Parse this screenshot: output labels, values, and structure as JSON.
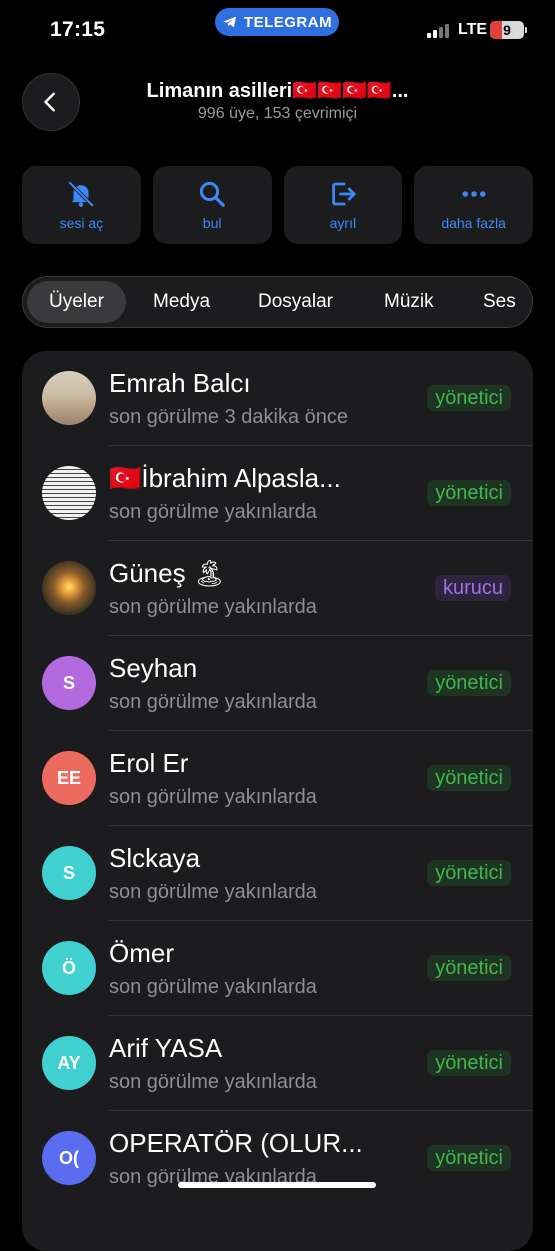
{
  "status_bar": {
    "time": "17:15",
    "app_pill": "TELEGRAM",
    "network": "LTE",
    "battery": "9"
  },
  "header": {
    "title": "Limanın asilleri🇹🇷🇹🇷🇹🇷🇹🇷...",
    "subtitle": "996 üye, 153 çevrimiçi"
  },
  "actions": [
    {
      "label": "sesi aç",
      "icon": "bell-slash-icon"
    },
    {
      "label": "bul",
      "icon": "search-icon"
    },
    {
      "label": "ayrıl",
      "icon": "leave-icon"
    },
    {
      "label": "daha fazla",
      "icon": "more-icon"
    }
  ],
  "tabs": [
    {
      "label": "Üyeler",
      "active": true
    },
    {
      "label": "Medya"
    },
    {
      "label": "Dosyalar"
    },
    {
      "label": "Müzik"
    },
    {
      "label": "Ses"
    }
  ],
  "members": [
    {
      "name": "Emrah Balcı",
      "status": "son görülme 3 dakika önce",
      "role": "yönetici",
      "avatar": "photo-beach",
      "initials": ""
    },
    {
      "name": "🇹🇷İbrahim Alpasla...",
      "status": "son görülme yakınlarda",
      "role": "yönetici",
      "avatar": "photo-text",
      "initials": ""
    },
    {
      "name": "Güneş 🏝",
      "status": "son görülme yakınlarda",
      "role": "kurucu",
      "avatar": "photo-sunset",
      "initials": ""
    },
    {
      "name": "Seyhan",
      "status": "son görülme yakınlarda",
      "role": "yönetici",
      "avatar": "initials",
      "initials": "S",
      "color": "#b36ae0"
    },
    {
      "name": "Erol Er",
      "status": "son görülme yakınlarda",
      "role": "yönetici",
      "avatar": "initials",
      "initials": "EE",
      "color": "#ec6a5e"
    },
    {
      "name": "Slckaya",
      "status": "son görülme yakınlarda",
      "role": "yönetici",
      "avatar": "initials",
      "initials": "S",
      "color": "#3fd0cf"
    },
    {
      "name": "Ömer",
      "status": "son görülme yakınlarda",
      "role": "yönetici",
      "avatar": "initials",
      "initials": "Ö",
      "color": "#3fd0cf"
    },
    {
      "name": "Arif YASA",
      "status": "son görülme yakınlarda",
      "role": "yönetici",
      "avatar": "initials",
      "initials": "AY",
      "color": "#3fd0cf"
    },
    {
      "name": "OPERATÖR (OLUR...",
      "status": "son görülme yakınlarda",
      "role": "yönetici",
      "avatar": "initials",
      "initials": "O(",
      "color": "#5a6cf0"
    }
  ],
  "colors": {
    "accent": "#3d88f5",
    "admin": "#3fb64f",
    "owner": "#a471e0"
  }
}
